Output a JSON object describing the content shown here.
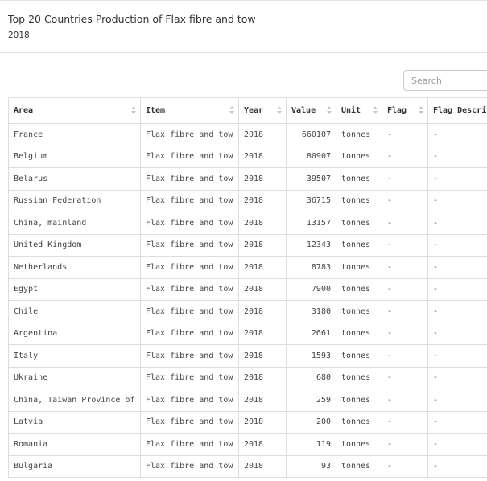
{
  "header": {
    "title": "Top 20 Countries Production of Flax fibre and tow",
    "subtitle": "2018"
  },
  "search": {
    "placeholder": "Search"
  },
  "table": {
    "columns": [
      "Area",
      "Item",
      "Year",
      "Value",
      "Unit",
      "Flag",
      "Flag Description"
    ],
    "rows": [
      [
        "France",
        "Flax fibre and tow",
        "2018",
        "660107",
        "tonnes",
        "-",
        "-"
      ],
      [
        "Belgium",
        "Flax fibre and tow",
        "2018",
        "80907",
        "tonnes",
        "-",
        "-"
      ],
      [
        "Belarus",
        "Flax fibre and tow",
        "2018",
        "39507",
        "tonnes",
        "-",
        "-"
      ],
      [
        "Russian Federation",
        "Flax fibre and tow",
        "2018",
        "36715",
        "tonnes",
        "-",
        "-"
      ],
      [
        "China, mainland",
        "Flax fibre and tow",
        "2018",
        "13157",
        "tonnes",
        "-",
        "-"
      ],
      [
        "United Kingdom",
        "Flax fibre and tow",
        "2018",
        "12343",
        "tonnes",
        "-",
        "-"
      ],
      [
        "Netherlands",
        "Flax fibre and tow",
        "2018",
        "8783",
        "tonnes",
        "-",
        "-"
      ],
      [
        "Egypt",
        "Flax fibre and tow",
        "2018",
        "7900",
        "tonnes",
        "-",
        "-"
      ],
      [
        "Chile",
        "Flax fibre and tow",
        "2018",
        "3180",
        "tonnes",
        "-",
        "-"
      ],
      [
        "Argentina",
        "Flax fibre and tow",
        "2018",
        "2661",
        "tonnes",
        "-",
        "-"
      ],
      [
        "Italy",
        "Flax fibre and tow",
        "2018",
        "1593",
        "tonnes",
        "-",
        "-"
      ],
      [
        "Ukraine",
        "Flax fibre and tow",
        "2018",
        "680",
        "tonnes",
        "-",
        "-"
      ],
      [
        "China, Taiwan Province of",
        "Flax fibre and tow",
        "2018",
        "259",
        "tonnes",
        "-",
        "-"
      ],
      [
        "Latvia",
        "Flax fibre and tow",
        "2018",
        "200",
        "tonnes",
        "-",
        "-"
      ],
      [
        "Romania",
        "Flax fibre and tow",
        "2018",
        "119",
        "tonnes",
        "-",
        "-"
      ],
      [
        "Bulgaria",
        "Flax fibre and tow",
        "2018",
        "93",
        "tonnes",
        "-",
        "-"
      ]
    ]
  }
}
